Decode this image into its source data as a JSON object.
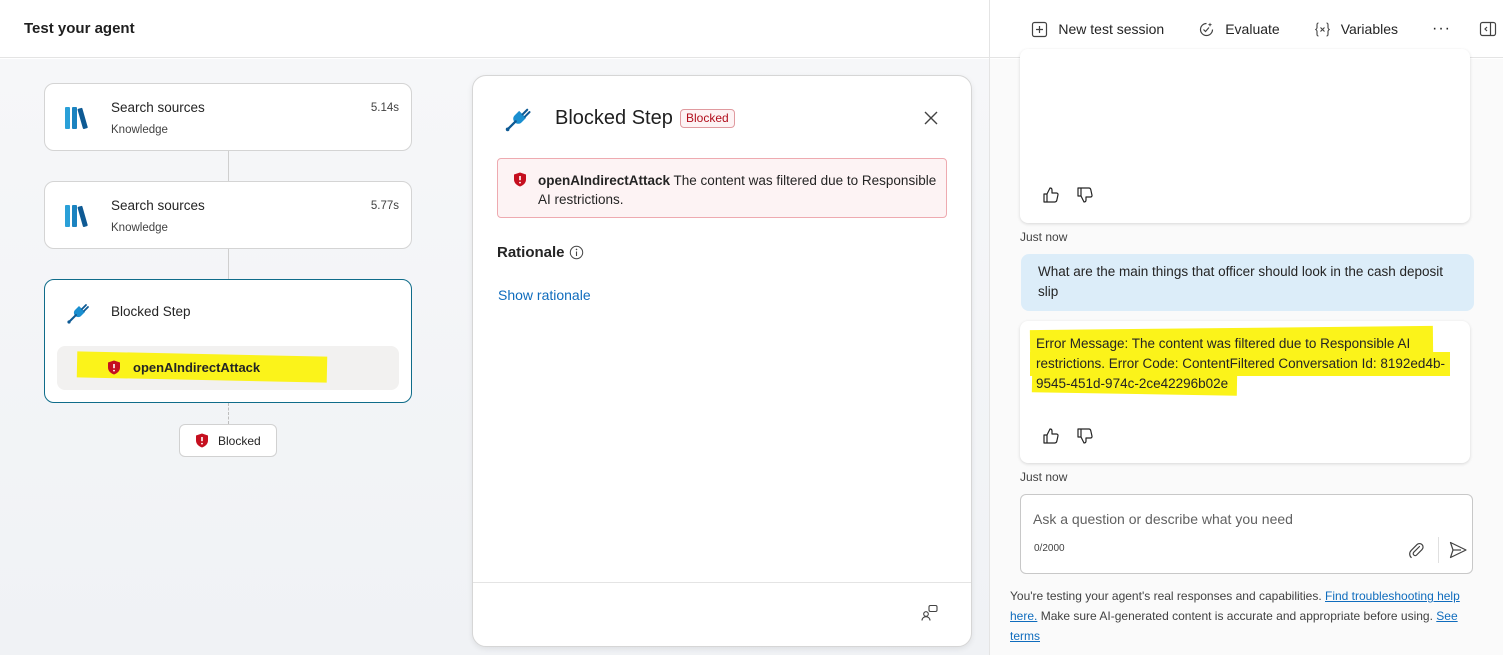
{
  "header": {
    "title": "Test your agent",
    "actions": [
      {
        "label": "New test session",
        "icon": "add-square-icon"
      },
      {
        "label": "Evaluate",
        "icon": "evaluate-icon"
      },
      {
        "label": "Variables",
        "icon": "variables-icon"
      }
    ],
    "more_label": "···"
  },
  "flow": {
    "nodes": [
      {
        "title": "Search sources",
        "subtitle": "Knowledge",
        "time": "5.14s",
        "icon": "books-icon"
      },
      {
        "title": "Search sources",
        "subtitle": "Knowledge",
        "time": "5.77s",
        "icon": "books-icon"
      }
    ],
    "blocked_node": {
      "title": "Blocked Step",
      "attack": "openAIndirectAttack",
      "icon": "plug-icon"
    },
    "blocked_chip": "Blocked"
  },
  "detail": {
    "title": "Blocked Step",
    "badge": "Blocked",
    "error_name": "openAIndirectAttack",
    "error_message": "The content was filtered due to Responsible AI restrictions.",
    "rationale_heading": "Rationale",
    "show_rationale": "Show rationale"
  },
  "chat": {
    "stamp_1": "Just now",
    "user_message": "What are the main things that officer should look in the cash deposit slip",
    "bot_error": "Error Message: The content was filtered due to Responsible AI restrictions. Error Code: ContentFiltered Conversation Id: 8192ed4b-9545-451d-974c-2ce42296b02e",
    "stamp_2": "Just now",
    "input_placeholder": "Ask a question or describe what you need",
    "counter": "0/2000",
    "disclaimer_1": "You're testing your agent's real responses and capabilities. ",
    "disclaimer_link_1": "Find troubleshooting help here.",
    "disclaimer_2": " Make sure AI-generated content is accurate and appropriate before using. ",
    "disclaimer_link_2": "See terms"
  },
  "colors": {
    "accent_blue": "#0f6cbd",
    "error_red": "#b10e1c",
    "highlight": "#fbf31a",
    "user_bubble": "#dcedf9"
  }
}
